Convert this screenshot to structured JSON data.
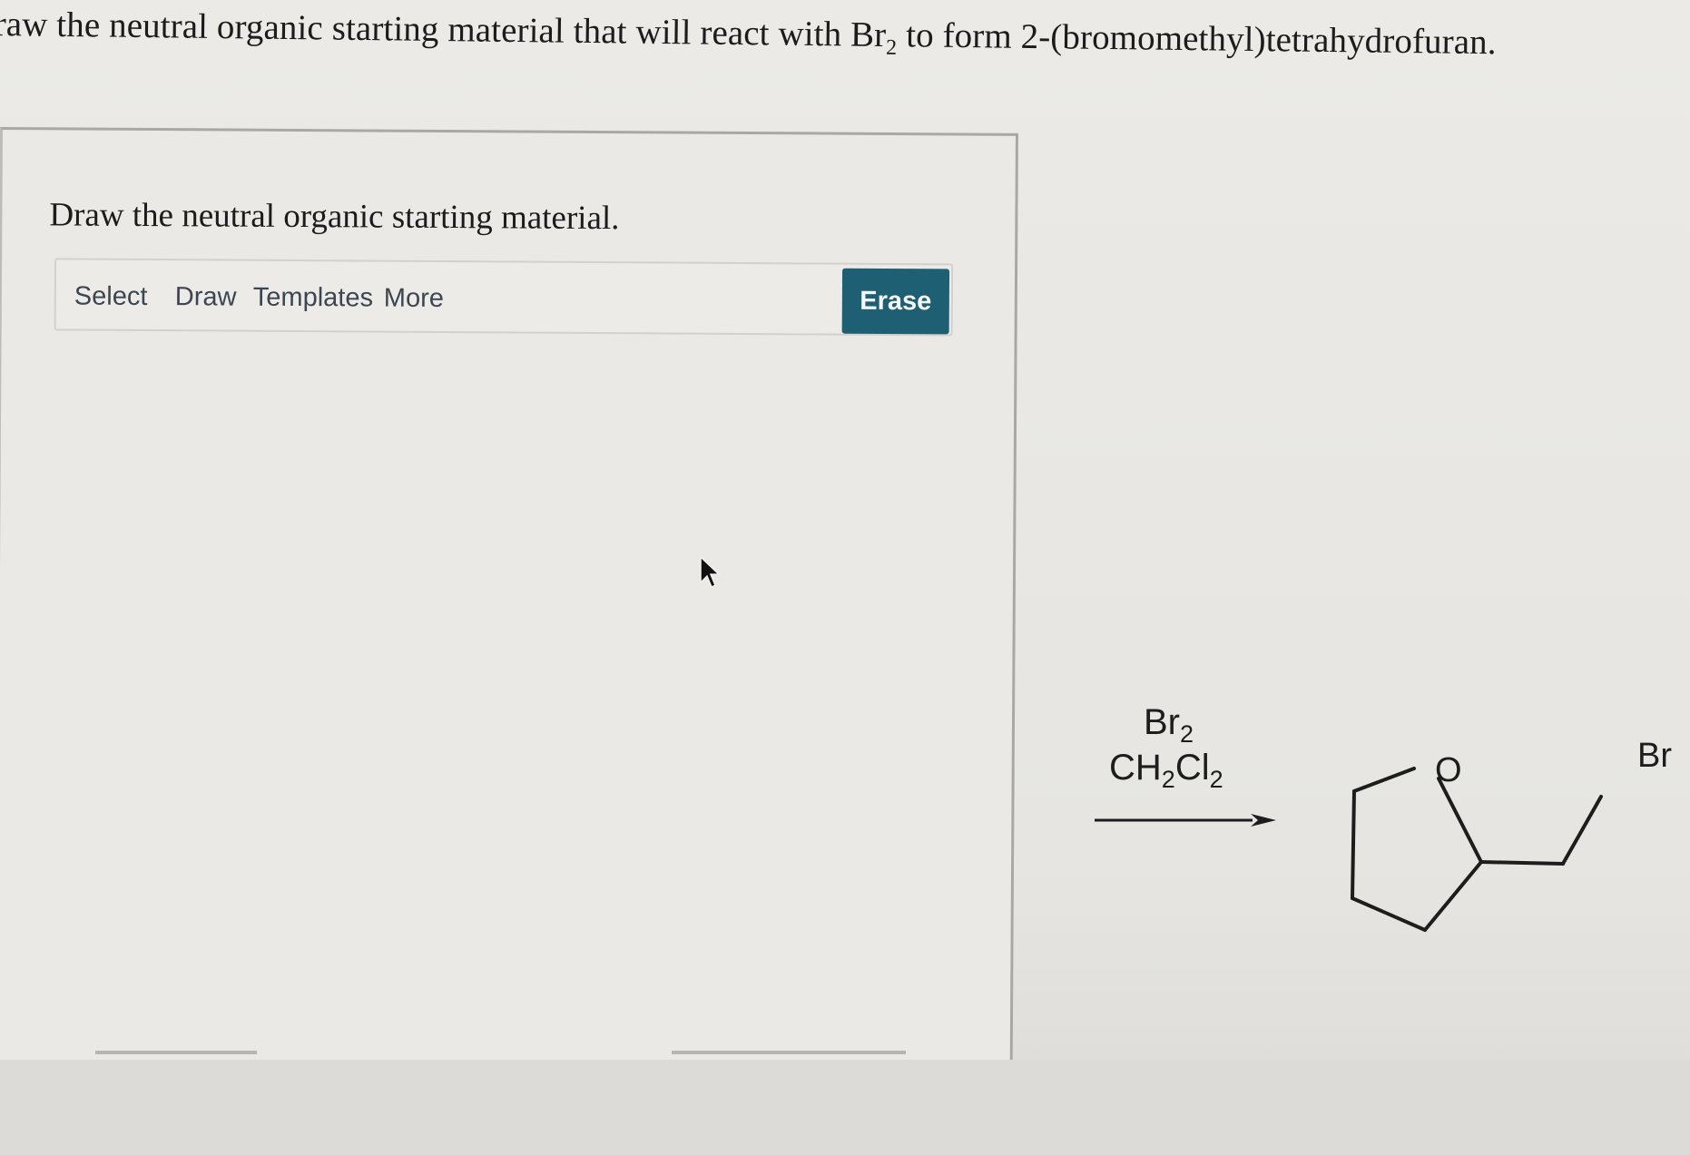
{
  "question": {
    "part1": "raw the neutral organic starting material that will react with Br",
    "subscript": "2",
    "part2": " to form 2-(bromomethyl)tetrahydrofuran."
  },
  "panel": {
    "prompt": "Draw the neutral organic starting material.",
    "toolbar": {
      "select": "Select",
      "draw": "Draw",
      "templates": "Templates",
      "more": "More",
      "erase": "Erase"
    }
  },
  "reaction": {
    "reagent1": {
      "base": "Br",
      "sub": "2"
    },
    "reagent2": {
      "c": "CH",
      "sub1": "2",
      "cl": "Cl",
      "sub2": "2"
    },
    "product_atoms": {
      "oxygen": "O",
      "bromine": "Br"
    }
  },
  "colors": {
    "erase_button": "#1f5f73",
    "toolbar_text": "#3b4652"
  },
  "icons": [
    "mouse-pointer-icon",
    "reaction-arrow-icon"
  ]
}
